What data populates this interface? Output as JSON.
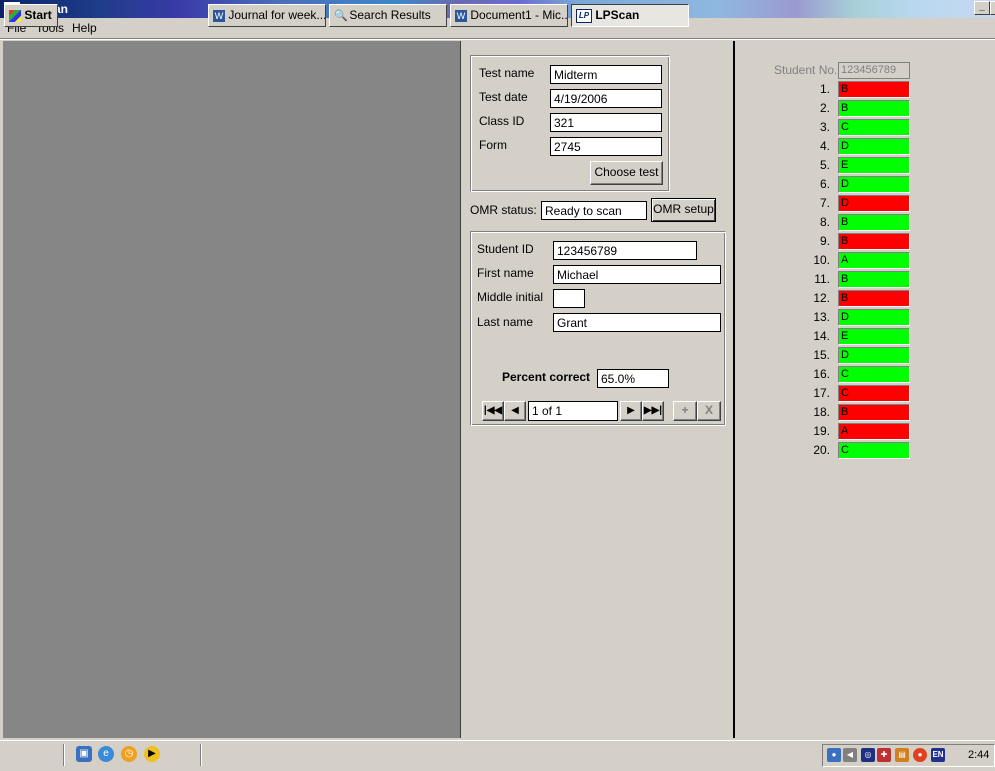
{
  "window": {
    "title": "LPScan"
  },
  "menu": [
    "File",
    "Tools",
    "Help"
  ],
  "test": {
    "name_label": "Test name",
    "name_value": "Midterm",
    "date_label": "Test date",
    "date_value": "4/19/2006",
    "class_label": "Class ID",
    "class_value": "321",
    "form_label": "Form",
    "form_value": "2745",
    "choose_button": "Choose test"
  },
  "omr": {
    "label": "OMR status:",
    "value": "Ready to scan",
    "setup_button": "OMR setup"
  },
  "student": {
    "id_label": "Student ID",
    "id_value": "123456789",
    "first_label": "First name",
    "first_value": "Michael",
    "middle_label": "Middle initial",
    "middle_value": "",
    "last_label": "Last name",
    "last_value": "Grant",
    "percent_label": "Percent correct",
    "percent_value": "65.0%"
  },
  "navigator": {
    "position": "1 of 1",
    "add": "+",
    "delete": "X"
  },
  "answers": {
    "student_no_label": "Student No.",
    "student_no_value": "123456789",
    "correct_color": "#00ff00",
    "wrong_color": "#ff0000",
    "items": [
      {
        "num": "1.",
        "answer": "B",
        "correct": false
      },
      {
        "num": "2.",
        "answer": "B",
        "correct": true
      },
      {
        "num": "3.",
        "answer": "C",
        "correct": true
      },
      {
        "num": "4.",
        "answer": "D",
        "correct": true
      },
      {
        "num": "5.",
        "answer": "E",
        "correct": true
      },
      {
        "num": "6.",
        "answer": "D",
        "correct": true
      },
      {
        "num": "7.",
        "answer": "D",
        "correct": false
      },
      {
        "num": "8.",
        "answer": "B",
        "correct": true
      },
      {
        "num": "9.",
        "answer": "B",
        "correct": false
      },
      {
        "num": "10.",
        "answer": "A",
        "correct": true
      },
      {
        "num": "11.",
        "answer": "B",
        "correct": true
      },
      {
        "num": "12.",
        "answer": "B",
        "correct": false
      },
      {
        "num": "13.",
        "answer": "D",
        "correct": true
      },
      {
        "num": "14.",
        "answer": "E",
        "correct": true
      },
      {
        "num": "15.",
        "answer": "D",
        "correct": true
      },
      {
        "num": "16.",
        "answer": "C",
        "correct": true
      },
      {
        "num": "17.",
        "answer": "C",
        "correct": false
      },
      {
        "num": "18.",
        "answer": "B",
        "correct": false
      },
      {
        "num": "19.",
        "answer": "A",
        "correct": false
      },
      {
        "num": "20.",
        "answer": "C",
        "correct": true
      }
    ]
  },
  "taskbar": {
    "start_label": "Start",
    "tasks": [
      "Journal for week...",
      "Search Results",
      "Document1 - Mic...",
      "LPScan"
    ],
    "tray_language": "EN",
    "clock": "2:44"
  }
}
